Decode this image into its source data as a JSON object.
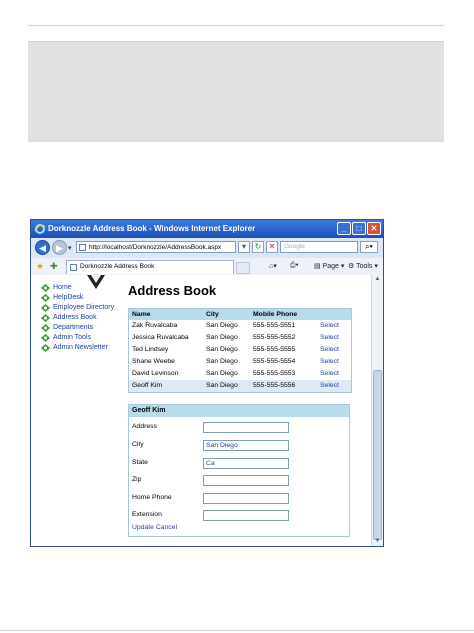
{
  "window": {
    "title": "Dorknozzle Address Book - Windows Internet Explorer",
    "address": "http://localhost/Dorknozzle/AddressBook.aspx",
    "search_placeholder": "Google",
    "tab_label": "Dorknozzle Address Book",
    "tools": {
      "page": "Page",
      "tools": "Tools"
    }
  },
  "menu": [
    {
      "label": "Home"
    },
    {
      "label": "HelpDesk"
    },
    {
      "label": "Employee Directory"
    },
    {
      "label": "Address Book"
    },
    {
      "label": "Departments"
    },
    {
      "label": "Admin Tools"
    },
    {
      "label": "Admin Newsletter"
    }
  ],
  "page": {
    "heading": "Address Book"
  },
  "grid": {
    "headers": {
      "name": "Name",
      "city": "City",
      "mobile": "Mobile Phone"
    },
    "rows": [
      {
        "name": "Zak Ruvalcaba",
        "city": "San Diego",
        "phone": "555-555-5551",
        "action": "Select"
      },
      {
        "name": "Jessica Ruvalcaba",
        "city": "San Diego",
        "phone": "555-555-5552",
        "action": "Select"
      },
      {
        "name": "Ted Lindsey",
        "city": "San Diego",
        "phone": "555-555-5555",
        "action": "Select"
      },
      {
        "name": "Shane Weebe",
        "city": "San Diego",
        "phone": "555-555-5554",
        "action": "Select"
      },
      {
        "name": "David Levinson",
        "city": "San Diego",
        "phone": "555-555-5553",
        "action": "Select"
      },
      {
        "name": "Geoff Kim",
        "city": "San Diego",
        "phone": "555-555-5556",
        "action": "Select"
      }
    ]
  },
  "detail": {
    "title": "Geoff Kim",
    "fields": [
      {
        "label": "Address",
        "value": ""
      },
      {
        "label": "City",
        "value": "San Diego"
      },
      {
        "label": "State",
        "value": "Ca"
      },
      {
        "label": "Zip",
        "value": ""
      },
      {
        "label": "Home Phone",
        "value": ""
      },
      {
        "label": "Extension",
        "value": ""
      }
    ],
    "update": "Update",
    "cancel": "Cancel"
  },
  "colors": {
    "grid_header": "#b8dce9",
    "link": "#1a3fa8",
    "selected_row": "#dfe8f5",
    "title_bar": "#2a62cc"
  }
}
